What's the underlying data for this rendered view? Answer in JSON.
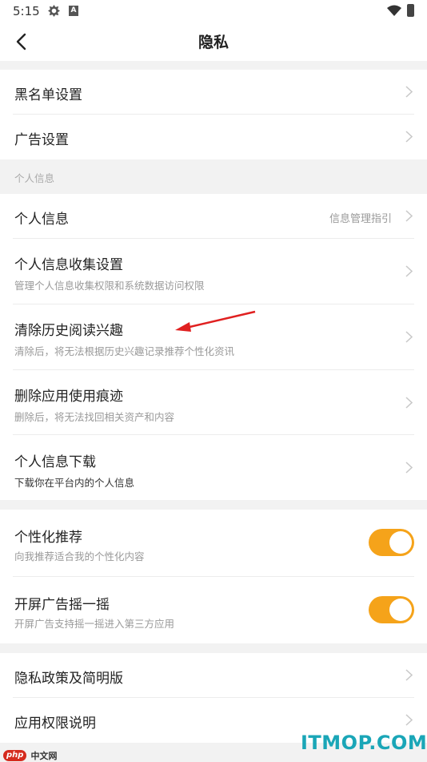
{
  "status_bar": {
    "time": "5:15",
    "icon_a": "A"
  },
  "nav": {
    "title": "隐私"
  },
  "group1": [
    {
      "title": "黑名单设置"
    },
    {
      "title": "广告设置"
    }
  ],
  "section_label": "个人信息",
  "group2": [
    {
      "title": "个人信息",
      "hint": "信息管理指引"
    },
    {
      "title": "个人信息收集设置",
      "subtitle": "管理个人信息收集权限和系统数据访问权限"
    },
    {
      "title": "清除历史阅读兴趣",
      "subtitle": "清除后，将无法根据历史兴趣记录推荐个性化资讯"
    },
    {
      "title": "删除应用使用痕迹",
      "subtitle": "删除后，将无法找回相关资产和内容"
    },
    {
      "title": "个人信息下载",
      "subtitle": "下载你在平台内的个人信息"
    }
  ],
  "group3": [
    {
      "title": "个性化推荐",
      "subtitle": "向我推荐适合我的个性化内容",
      "enabled": true
    },
    {
      "title": "开屏广告摇一摇",
      "subtitle": "开屏广告支持摇一摇进入第三方应用",
      "enabled": true
    }
  ],
  "group4": [
    {
      "title": "隐私政策及简明版"
    },
    {
      "title": "应用权限说明"
    }
  ],
  "colors": {
    "accent": "#f5a31a",
    "annotation_arrow": "#e02020",
    "watermark": "#1aa6b7"
  },
  "watermarks": {
    "left_badge": "php",
    "left_text": "中文网",
    "right_text": "ITMOP.COM"
  }
}
